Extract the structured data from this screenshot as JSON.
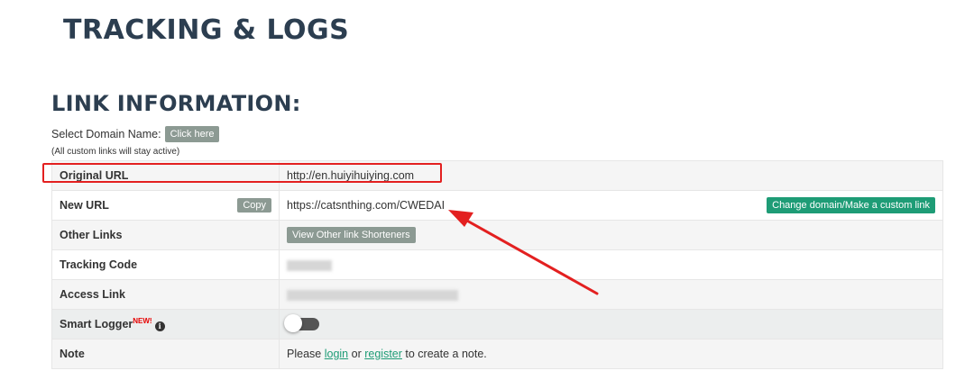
{
  "page_title": "TRACKING & LOGS",
  "section_title": "LINK INFORMATION:",
  "domain": {
    "label": "Select Domain Name:",
    "button": "Click here",
    "note": "(All custom links will stay active)"
  },
  "rows": {
    "original_url": {
      "label": "Original URL",
      "value": "http://en.huiyihuiying.com"
    },
    "new_url": {
      "label": "New URL",
      "copy": "Copy",
      "value": "https://catsnthing.com/CWEDAI",
      "change_button": "Change domain/Make a custom link"
    },
    "other_links": {
      "label": "Other Links",
      "button": "View Other link Shorteners"
    },
    "tracking_code": {
      "label": "Tracking Code"
    },
    "access_link": {
      "label": "Access Link"
    },
    "smart_logger": {
      "label": "Smart Logger",
      "badge": "NEW!",
      "info_icon": "i",
      "enabled": false
    },
    "note": {
      "label": "Note",
      "prefix": "Please",
      "login": "login",
      "or": "or",
      "register": "register",
      "suffix": "to create a note."
    }
  },
  "colors": {
    "heading": "#2c3e50",
    "green_button": "#1e9c76",
    "grey_button": "#8c9a93",
    "annotation_red": "#e32020"
  },
  "annotation_icons": [
    "highlight-box",
    "arrow-icon"
  ]
}
